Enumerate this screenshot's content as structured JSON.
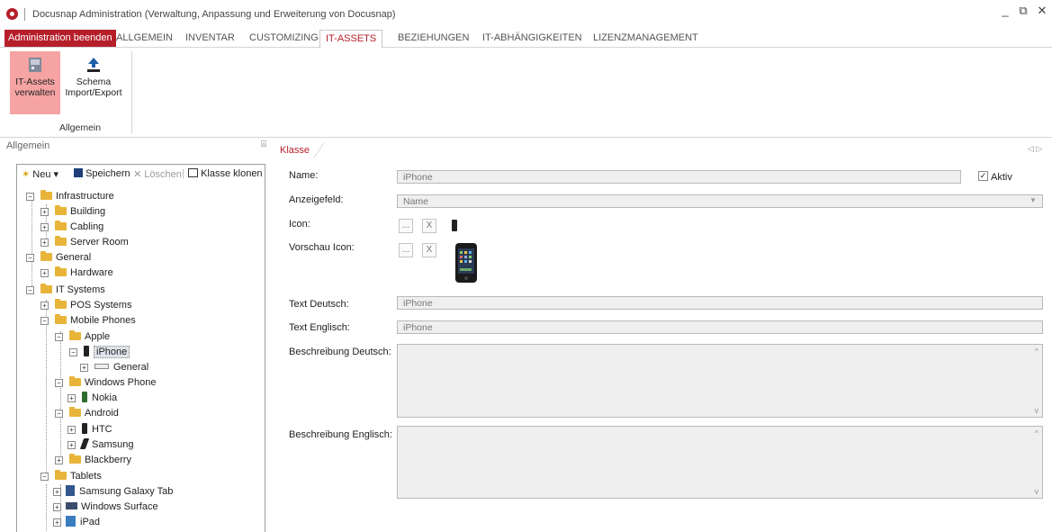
{
  "window": {
    "title": "Docusnap Administration (Verwaltung, Anpassung und Erweiterung von Docusnap)",
    "minimize": "_",
    "restore": "⧉",
    "close": "✕"
  },
  "tabs": [
    {
      "label": "Administration beenden"
    },
    {
      "label": "ALLGEMEIN"
    },
    {
      "label": "INVENTAR"
    },
    {
      "label": "CUSTOMIZING"
    },
    {
      "label": "IT-ASSETS"
    },
    {
      "label": "BEZIEHUNGEN"
    },
    {
      "label": "IT-ABHÄNGIGKEITEN"
    },
    {
      "label": "LIZENZMANAGEMENT"
    }
  ],
  "ribbon": {
    "btn1_line1": "IT-Assets",
    "btn1_line2": "verwalten",
    "btn2_line1": "Schema",
    "btn2_line2": "Import/Export",
    "group_label": "Allgemein"
  },
  "left_panel": {
    "title": "Allgemein",
    "pin": "⍓",
    "toolbar": {
      "new": "Neu",
      "dropdown": "▾",
      "save": "Speichern",
      "delete": "Löschen",
      "clone": "Klasse klonen"
    },
    "tree": [
      "Infrastructure",
      "Building",
      "Cabling",
      "Server Room",
      "General",
      "Hardware",
      "IT Systems",
      "POS Systems",
      "Mobile Phones",
      "Apple",
      "iPhone",
      "General",
      "Windows Phone",
      "Nokia",
      "Android",
      "HTC",
      "Samsung",
      "Blackberry",
      "Tablets",
      "Samsung Galaxy Tab",
      "Windows Surface",
      "iPad"
    ]
  },
  "detail": {
    "tab": "Klasse",
    "nav": "◁ ▷",
    "name_label": "Name:",
    "name_value": "iPhone",
    "aktiv_label": "Aktiv",
    "aktiv_checked": "✓",
    "anzeige_label": "Anzeigefeld:",
    "anzeige_value": "Name",
    "icon_label": "Icon:",
    "vorschau_label": "Vorschau Icon:",
    "browse_btn": "...",
    "clear_btn": "X",
    "text_de_label": "Text Deutsch:",
    "text_de_value": "iPhone",
    "text_en_label": "Text Englisch:",
    "text_en_value": "iPhone",
    "beschr_de_label": "Beschreibung Deutsch:",
    "beschr_en_label": "Beschreibung Englisch:"
  }
}
